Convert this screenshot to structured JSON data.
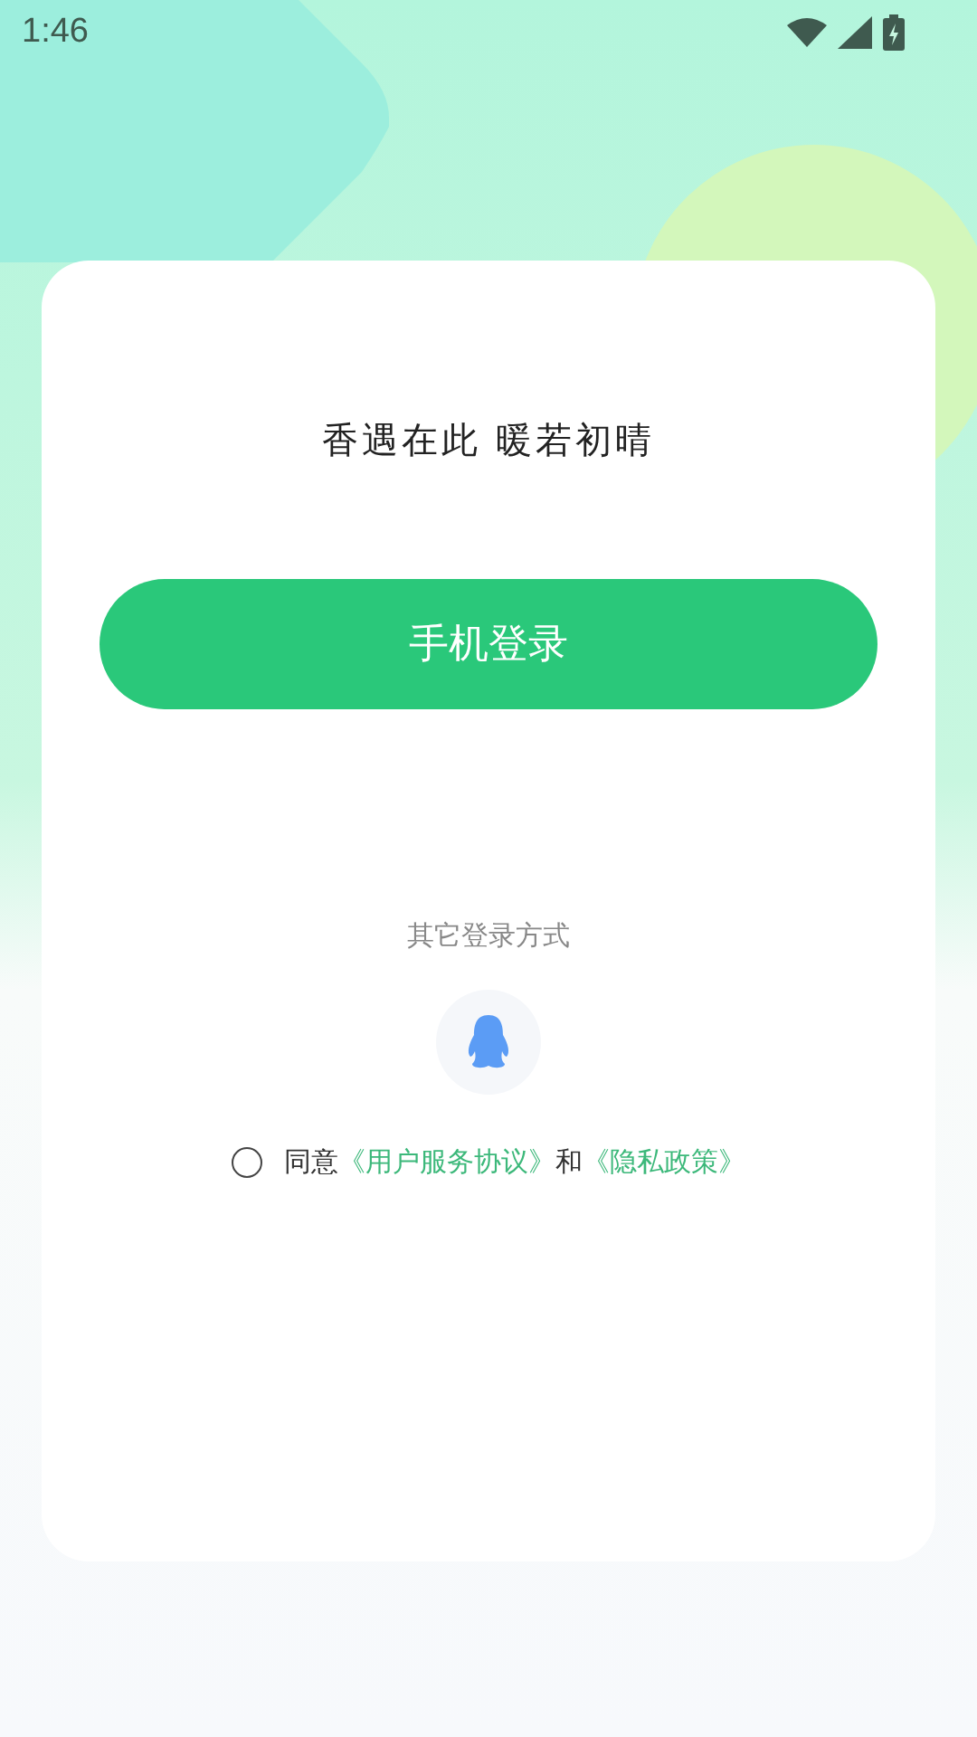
{
  "status_bar": {
    "time": "1:46"
  },
  "slogan": "香遇在此 暖若初晴",
  "login_button": "手机登录",
  "other_login": {
    "label": "其它登录方式"
  },
  "agreement": {
    "checked": false,
    "prefix": "同意",
    "links": [
      {
        "text": "《用户服务协议》"
      },
      {
        "text": "《隐私政策》"
      }
    ],
    "joiner": "和"
  }
}
